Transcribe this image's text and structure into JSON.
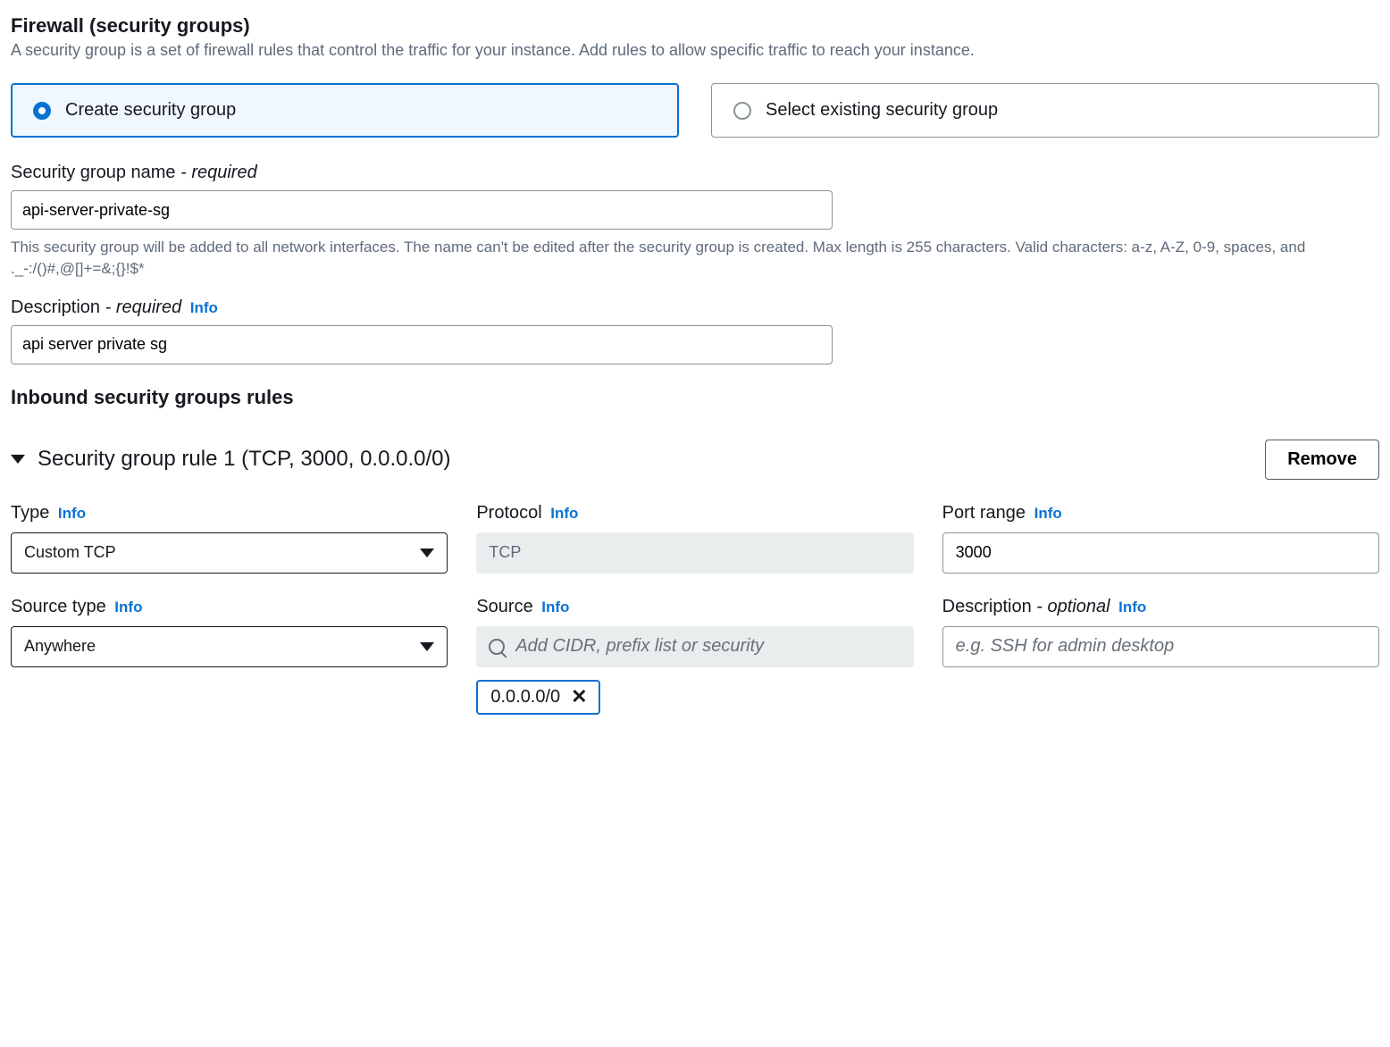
{
  "header": {
    "title": "Firewall (security groups)",
    "description": "A security group is a set of firewall rules that control the traffic for your instance. Add rules to allow specific traffic to reach your instance."
  },
  "radio": {
    "create": "Create security group",
    "select": "Select existing security group"
  },
  "sg_name": {
    "label": "Security group name",
    "required": "- required",
    "value": "api-server-private-sg",
    "hint": "This security group will be added to all network interfaces. The name can't be edited after the security group is created. Max length is 255 characters. Valid characters: a-z, A-Z, 0-9, spaces, and ._-:/()#,@[]+=&;{}!$*"
  },
  "sg_desc": {
    "label": "Description",
    "required": "- required",
    "info": "Info",
    "value": "api server private sg"
  },
  "inbound_heading": "Inbound security groups rules",
  "rule": {
    "title": "Security group rule 1 (TCP, 3000, 0.0.0.0/0)",
    "remove": "Remove",
    "type_label": "Type",
    "type_value": "Custom TCP",
    "protocol_label": "Protocol",
    "protocol_value": "TCP",
    "port_label": "Port range",
    "port_value": "3000",
    "source_type_label": "Source type",
    "source_type_value": "Anywhere",
    "source_label": "Source",
    "source_placeholder": "Add CIDR, prefix list or security",
    "source_tag": "0.0.0.0/0",
    "desc_label": "Description",
    "desc_optional": "- optional",
    "desc_placeholder": "e.g. SSH for admin desktop",
    "info": "Info"
  }
}
